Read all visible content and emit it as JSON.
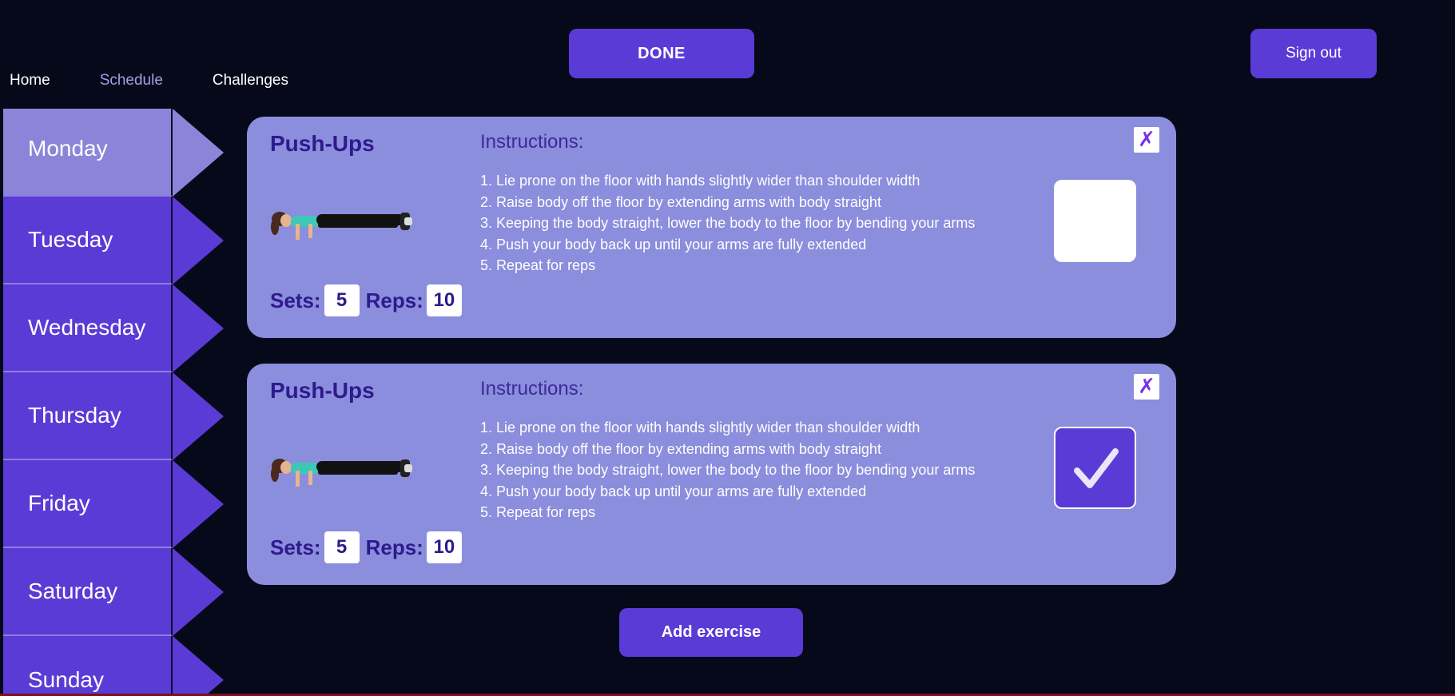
{
  "header": {
    "done_label": "DONE",
    "signout_label": "Sign out"
  },
  "nav": {
    "items": [
      {
        "label": "Home"
      },
      {
        "label": "Schedule",
        "active": true
      },
      {
        "label": "Challenges"
      }
    ]
  },
  "days": {
    "items": [
      {
        "label": "Monday",
        "active": true
      },
      {
        "label": "Tuesday"
      },
      {
        "label": "Wednesday"
      },
      {
        "label": "Thursday"
      },
      {
        "label": "Friday"
      },
      {
        "label": "Saturday"
      },
      {
        "label": "Sunday"
      }
    ]
  },
  "exercises": [
    {
      "title": "Push-Ups",
      "instructions_heading": "Instructions:",
      "steps": [
        "1. Lie prone on the floor with hands slightly wider than shoulder width",
        "2. Raise body off the floor by extending arms with body straight",
        "3. Keeping the body straight, lower the body to the floor by bending your arms",
        "4. Push your body back up until your arms are fully extended",
        "5. Repeat for reps"
      ],
      "sets_label": "Sets:",
      "sets": "5",
      "reps_label": "Reps:",
      "reps": "10",
      "close_glyph": "✗",
      "completed": false
    },
    {
      "title": "Push-Ups",
      "instructions_heading": "Instructions:",
      "steps": [
        "1. Lie prone on the floor with hands slightly wider than shoulder width",
        "2. Raise body off the floor by extending arms with body straight",
        "3. Keeping the body straight, lower the body to the floor by bending your arms",
        "4. Push your body back up until your arms are fully extended",
        "5. Repeat for reps"
      ],
      "sets_label": "Sets:",
      "sets": "5",
      "reps_label": "Reps:",
      "reps": "10",
      "close_glyph": "✗",
      "completed": true
    }
  ],
  "footer": {
    "add_label": "Add exercise"
  },
  "colors": {
    "background": "#06091a",
    "accent": "#5b3bd6",
    "card": "#8b8ddd",
    "active_day": "#8b85d9",
    "title_text": "#2e1a8c",
    "close_x": "#7b2fe6"
  },
  "icons": {
    "close": "close-icon",
    "check": "checkmark-icon",
    "illustration": "pushup-illustration"
  }
}
